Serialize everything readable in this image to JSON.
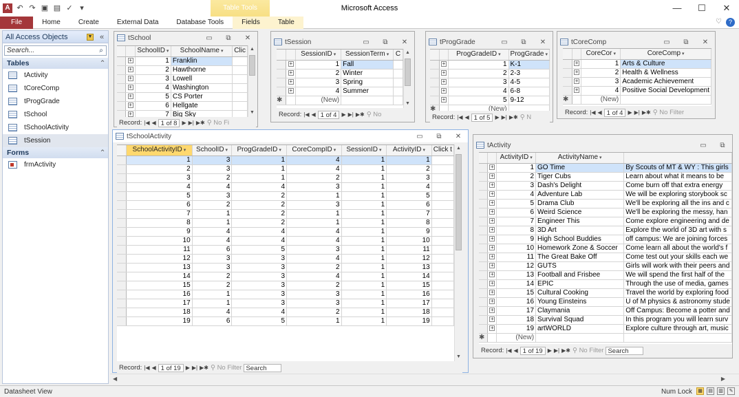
{
  "titlebar": {
    "title": "Microsoft Access",
    "context_group": "Table Tools",
    "logo": "A",
    "minimize": "—",
    "maximize": "☐",
    "close": "✕"
  },
  "ribbon": {
    "tabs": [
      "File",
      "Home",
      "Create",
      "External Data",
      "Database Tools",
      "Fields",
      "Table"
    ]
  },
  "nav": {
    "header": "All Access Objects",
    "search_placeholder": "Search...",
    "tables_label": "Tables",
    "forms_label": "Forms",
    "tables": [
      "tActivity",
      "tCoreComp",
      "tProgGrade",
      "tSchool",
      "tSchoolActivity",
      "tSession"
    ],
    "forms": [
      "frmActivity"
    ]
  },
  "tSchool": {
    "title": "tSchool",
    "cols": [
      "SchoolID",
      "SchoolName",
      "Clic"
    ],
    "rows": [
      [
        "1",
        "Franklin"
      ],
      [
        "2",
        "Hawthorne"
      ],
      [
        "3",
        "Lowell"
      ],
      [
        "4",
        "Washington"
      ],
      [
        "5",
        "CS Porter"
      ],
      [
        "6",
        "Hellgate"
      ],
      [
        "7",
        "Big Sky"
      ]
    ],
    "record": "1 of 8",
    "nofilter": "No Fi"
  },
  "tSession": {
    "title": "tSession",
    "cols": [
      "SessionID",
      "SessionTerm",
      "C"
    ],
    "rows": [
      [
        "1",
        "Fall"
      ],
      [
        "2",
        "Winter"
      ],
      [
        "3",
        "Spring"
      ],
      [
        "4",
        "Summer"
      ]
    ],
    "newrow": "(New)",
    "record": "1 of 4",
    "nofilter": "No"
  },
  "tProgGrade": {
    "title": "tProgGrade",
    "cols": [
      "ProgGradeID",
      "ProgGrade"
    ],
    "rows": [
      [
        "1",
        "K-1"
      ],
      [
        "2",
        "2-3"
      ],
      [
        "3",
        "4-5"
      ],
      [
        "4",
        "6-8"
      ],
      [
        "5",
        "9-12"
      ]
    ],
    "newrow": "(New)",
    "record": "1 of 5",
    "nofilter": "N"
  },
  "tCoreComp": {
    "title": "tCoreComp",
    "cols": [
      "CoreCor",
      "CoreComp"
    ],
    "rows": [
      [
        "1",
        "Arts & Culture"
      ],
      [
        "2",
        "Health & Wellness"
      ],
      [
        "3",
        "Academic Achievement"
      ],
      [
        "4",
        "Positive Social Development"
      ]
    ],
    "newrow": "(New)",
    "record": "1 of 4",
    "nofilter": "No Filter"
  },
  "tSchoolActivity": {
    "title": "tSchoolActivity",
    "cols": [
      "SchoolActivityID",
      "SchoolID",
      "ProgGradeID",
      "CoreCompID",
      "SessionID",
      "ActivityID",
      "Click t"
    ],
    "rows": [
      [
        1,
        3,
        1,
        4,
        1,
        1
      ],
      [
        2,
        3,
        1,
        4,
        1,
        2
      ],
      [
        3,
        2,
        1,
        2,
        1,
        3
      ],
      [
        4,
        4,
        4,
        3,
        1,
        4
      ],
      [
        5,
        3,
        2,
        1,
        1,
        5
      ],
      [
        6,
        2,
        2,
        3,
        1,
        6
      ],
      [
        7,
        1,
        2,
        1,
        1,
        7
      ],
      [
        8,
        1,
        2,
        1,
        1,
        8
      ],
      [
        9,
        4,
        4,
        4,
        1,
        9
      ],
      [
        10,
        4,
        4,
        4,
        1,
        10
      ],
      [
        11,
        6,
        5,
        3,
        1,
        11
      ],
      [
        12,
        3,
        3,
        4,
        1,
        12
      ],
      [
        13,
        3,
        3,
        2,
        1,
        13
      ],
      [
        14,
        2,
        3,
        4,
        1,
        14
      ],
      [
        15,
        2,
        3,
        2,
        1,
        15
      ],
      [
        16,
        1,
        3,
        3,
        1,
        16
      ],
      [
        17,
        1,
        3,
        3,
        1,
        17
      ],
      [
        18,
        4,
        4,
        2,
        1,
        18
      ],
      [
        19,
        6,
        5,
        1,
        1,
        19
      ]
    ],
    "record": "1 of 19",
    "nofilter": "No Filter",
    "search": "Search"
  },
  "tActivity": {
    "title": "tActivity",
    "cols": [
      "ActivityID",
      "ActivityName",
      ""
    ],
    "rows": [
      [
        "1",
        "GO Time",
        "By Scouts of MT & WY : This girls"
      ],
      [
        "2",
        "Tiger Cubs",
        "Learn about what it means to be"
      ],
      [
        "3",
        "Dash's Delight",
        "Come burn off that extra energy"
      ],
      [
        "4",
        "Adventure Lab",
        "We will be exploring storybook sc"
      ],
      [
        "5",
        "Drama Club",
        "We'll be exploring all the ins and c"
      ],
      [
        "6",
        "Weird Science",
        "We'll be exploring the messy, han"
      ],
      [
        "7",
        "Engineer This",
        "Come explore engineering and de"
      ],
      [
        "8",
        "3D Art",
        "Explore the world of 3D art with s"
      ],
      [
        "9",
        "High School Buddies",
        "off campus: We are joining forces"
      ],
      [
        "10",
        "Homework Zone & Soccer",
        "Come learn all about the world's f"
      ],
      [
        "11",
        "The Great Bake Off",
        "Come test out your skills each we"
      ],
      [
        "12",
        "GUTS",
        "Girls will work with their peers and"
      ],
      [
        "13",
        "Football and Frisbee",
        "We will spend the first half of the"
      ],
      [
        "14",
        "EPIC",
        "Through the use of media, games"
      ],
      [
        "15",
        "Cultural Cooking",
        "Travel the world by exploring food"
      ],
      [
        "16",
        "Young Einsteins",
        "U of M physics & astronomy stude"
      ],
      [
        "17",
        "Claymania",
        "Off Campus: Become a potter and"
      ],
      [
        "18",
        "Survival Squad",
        "In this program you will learn surv"
      ],
      [
        "19",
        "artWORLD",
        "Explore culture through art, music"
      ]
    ],
    "newrow": "(New)",
    "record": "1 of 19",
    "nofilter": "No Filter",
    "search": "Search"
  },
  "common": {
    "record_label": "Record:"
  },
  "status": {
    "left": "Datasheet View",
    "numlock": "Num Lock"
  }
}
